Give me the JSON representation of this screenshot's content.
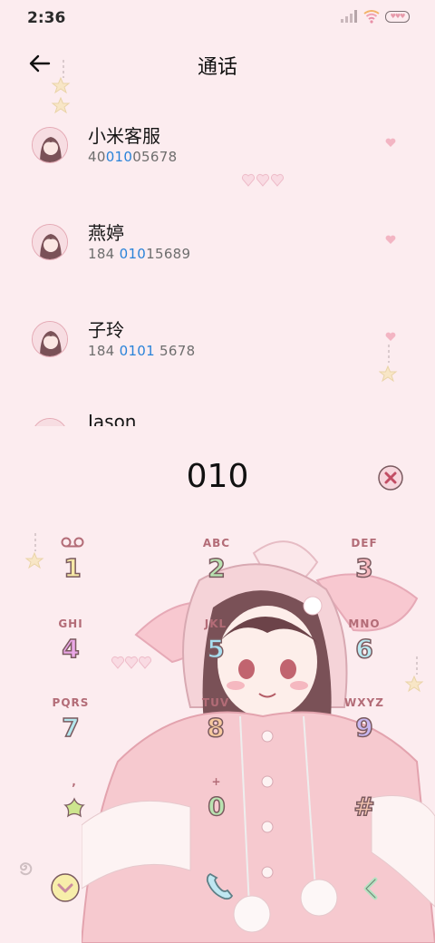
{
  "status_bar": {
    "time": "2:36",
    "battery_text": "♥♥♥"
  },
  "header": {
    "title": "通话"
  },
  "contacts": [
    {
      "name": "小米客服",
      "number_pre": "40",
      "number_match": "010",
      "number_post": "05678"
    },
    {
      "name": "燕婷",
      "number_pre": "184 ",
      "number_match": "010",
      "number_post": "15689"
    },
    {
      "name": "子玲",
      "number_pre": "184 ",
      "number_match": "0101",
      "number_post": " 5678"
    },
    {
      "name": "Jason",
      "number_pre": "",
      "number_match": "",
      "number_post": ""
    }
  ],
  "dialer": {
    "number": "010"
  },
  "keypad": [
    {
      "digit": "1",
      "letters": "",
      "color": "#f6e8a6",
      "icon": "voicemail-icon"
    },
    {
      "digit": "2",
      "letters": "ABC",
      "color": "#b9e3b1",
      "icon": ""
    },
    {
      "digit": "3",
      "letters": "DEF",
      "color": "#f6b9bf",
      "icon": ""
    },
    {
      "digit": "4",
      "letters": "GHI",
      "color": "#eaa6e6",
      "icon": ""
    },
    {
      "digit": "5",
      "letters": "JKL",
      "color": "#a9dff0",
      "icon": ""
    },
    {
      "digit": "6",
      "letters": "MNO",
      "color": "#b9e8f0",
      "icon": ""
    },
    {
      "digit": "7",
      "letters": "PQRS",
      "color": "#b3e6ec",
      "icon": ""
    },
    {
      "digit": "8",
      "letters": "TUV",
      "color": "#f6c99e",
      "icon": ""
    },
    {
      "digit": "9",
      "letters": "WXYZ",
      "color": "#c7b6ef",
      "icon": ""
    },
    {
      "digit": "*",
      "letters": ",",
      "color": "#cde58e",
      "icon": "star-icon"
    },
    {
      "digit": "0",
      "letters": "+",
      "color": "#b9e3b1",
      "icon": ""
    },
    {
      "digit": "#",
      "letters": "",
      "color": "#f6c6b1",
      "icon": ""
    }
  ],
  "colors": {
    "background": "#fcecef",
    "highlight": "#2a83d9",
    "key_label": "#b36c77"
  }
}
